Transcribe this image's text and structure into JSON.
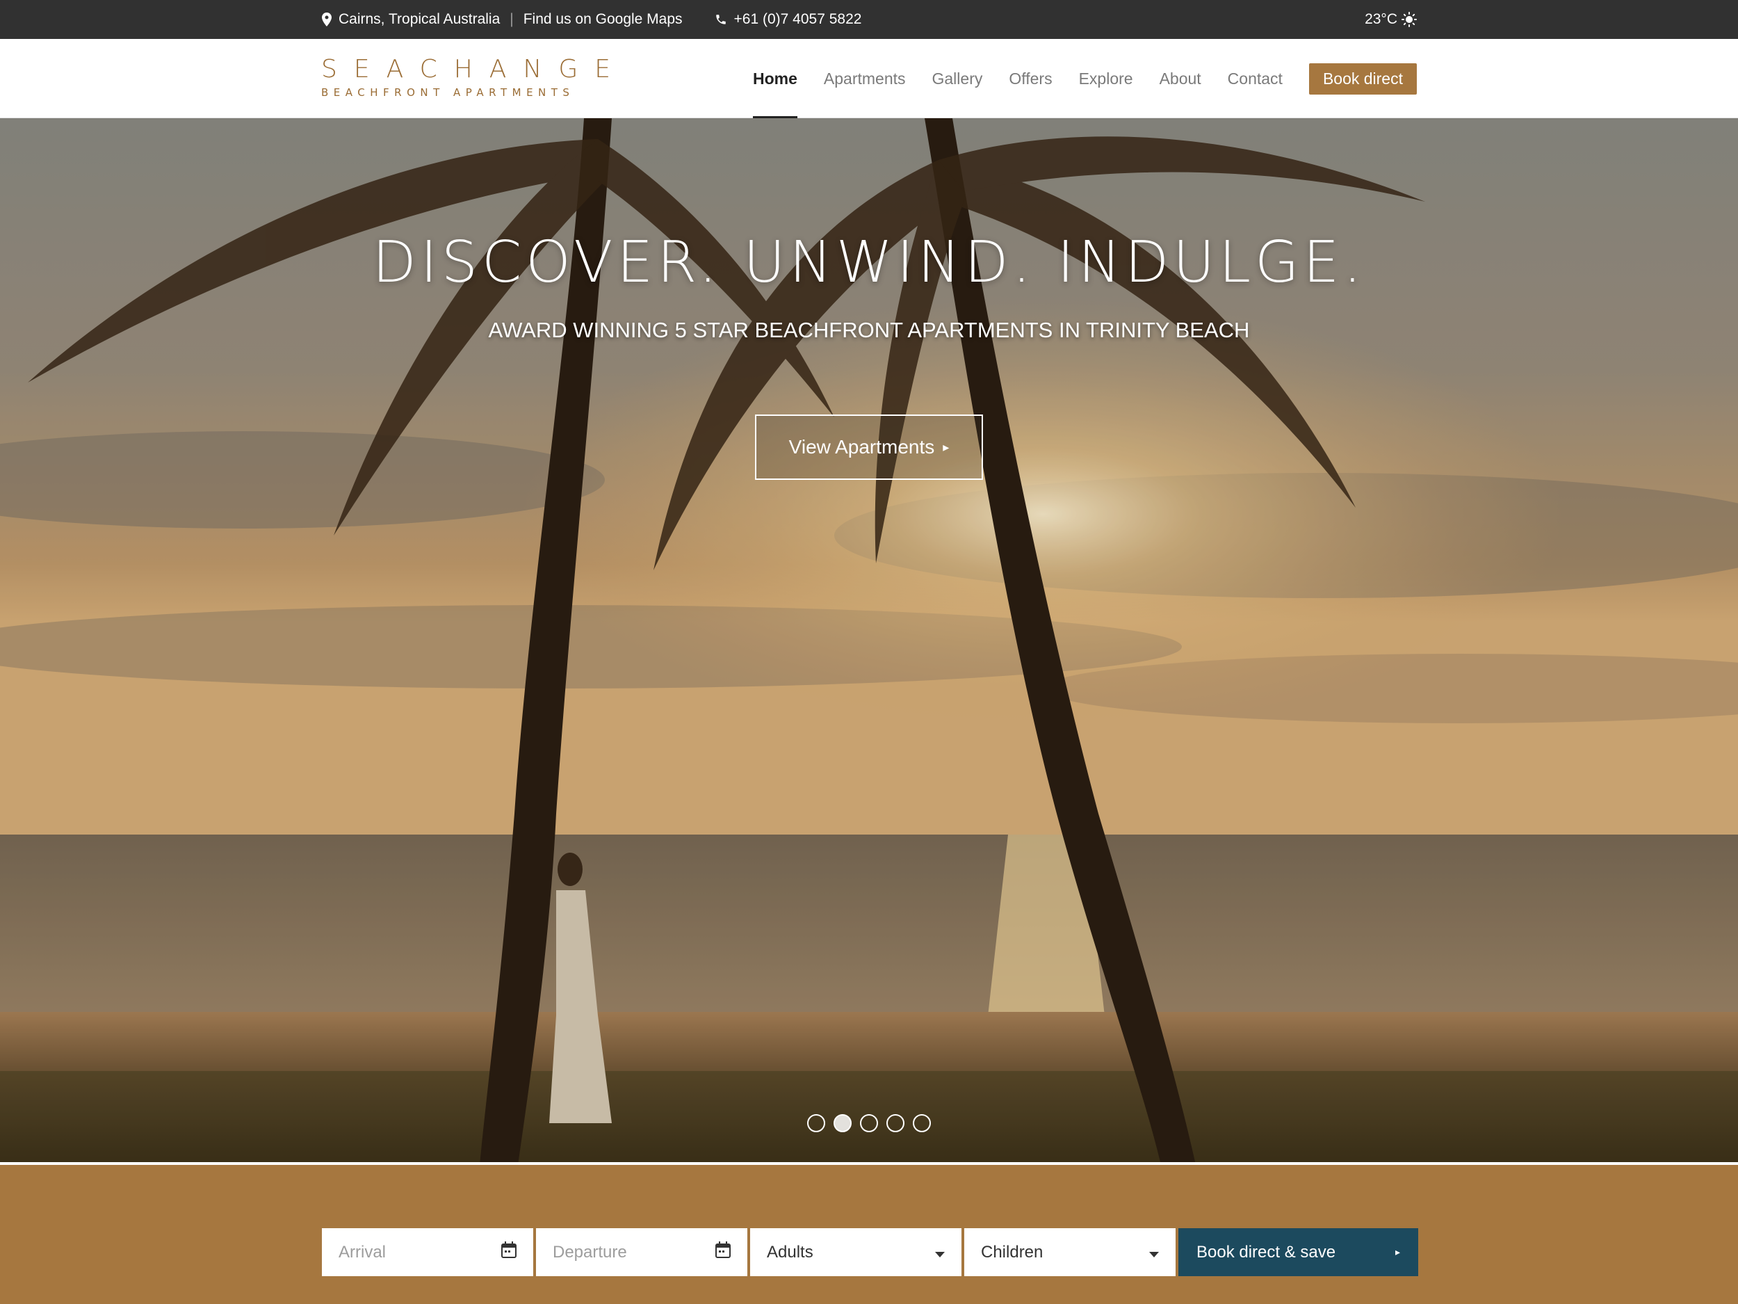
{
  "topbar": {
    "location": "Cairns, Tropical Australia",
    "separator": "|",
    "maps_link": "Find us on Google Maps",
    "phone": "+61 (0)7 4057 5822",
    "weather": "23°C",
    "icons": [
      "map-pin-icon",
      "phone-icon",
      "sun-icon"
    ]
  },
  "logo": {
    "line1": "SEACHANGE",
    "line2": "BEACHFRONT APARTMENTS"
  },
  "nav": {
    "items": [
      {
        "label": "Home",
        "active": true
      },
      {
        "label": "Apartments"
      },
      {
        "label": "Gallery"
      },
      {
        "label": "Offers"
      },
      {
        "label": "Explore"
      },
      {
        "label": "About"
      },
      {
        "label": "Contact"
      }
    ],
    "book_label": "Book direct"
  },
  "hero": {
    "title": "DISCOVER. UNWIND. INDULGE.",
    "subtitle": "AWARD WINNING 5 STAR BEACHFRONT APARTMENTS IN TRINITY BEACH",
    "button_label": "View Apartments",
    "slides_count": 5,
    "active_slide": 2
  },
  "booking": {
    "arrival_placeholder": "Arrival",
    "departure_placeholder": "Departure",
    "adults_label": "Adults",
    "children_label": "Children",
    "submit_label": "Book direct & save"
  },
  "colors": {
    "topbar_bg": "#313131",
    "brand_gold": "#a6773f",
    "submit_navy": "#1c4a5e"
  }
}
